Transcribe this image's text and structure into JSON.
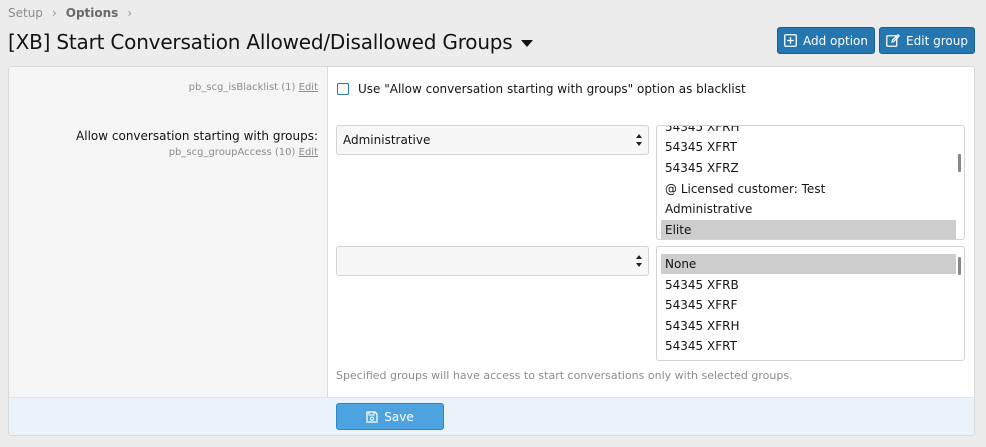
{
  "breadcrumb": {
    "items": [
      "Setup",
      "Options"
    ]
  },
  "page": {
    "title": "[XB] Start Conversation Allowed/Disallowed Groups"
  },
  "header_buttons": {
    "add_option": "Add option",
    "edit_group": "Edit group"
  },
  "options": {
    "blacklist": {
      "meta": "pb_scg_isBlacklist (1)",
      "edit_link": "Edit",
      "checkbox_label": "Use \"Allow conversation starting with groups\" option as blacklist",
      "checked": false
    },
    "group_access": {
      "label": "Allow conversation starting with groups:",
      "meta": "pb_scg_groupAccess (10)",
      "edit_link": "Edit",
      "row1": {
        "select_value": "Administrative",
        "list_items": [
          "54345 XFRH",
          "54345 XFRT",
          "54345 XFRZ",
          "@ Licensed customer: Test",
          "Administrative",
          "Elite"
        ],
        "selected": "Elite"
      },
      "row2": {
        "select_value": "",
        "list_items": [
          "None",
          "54345 XFRB",
          "54345 XFRF",
          "54345 XFRH",
          "54345 XFRT"
        ],
        "selected": "None"
      },
      "hint": "Specified groups will have access to start conversations only with selected groups."
    }
  },
  "footer": {
    "save_label": "Save"
  },
  "colors": {
    "primary": "#2577b1",
    "save": "#4da3e0",
    "selected_option": "#cdcdcd",
    "footer_bg": "#eaf3fa"
  }
}
